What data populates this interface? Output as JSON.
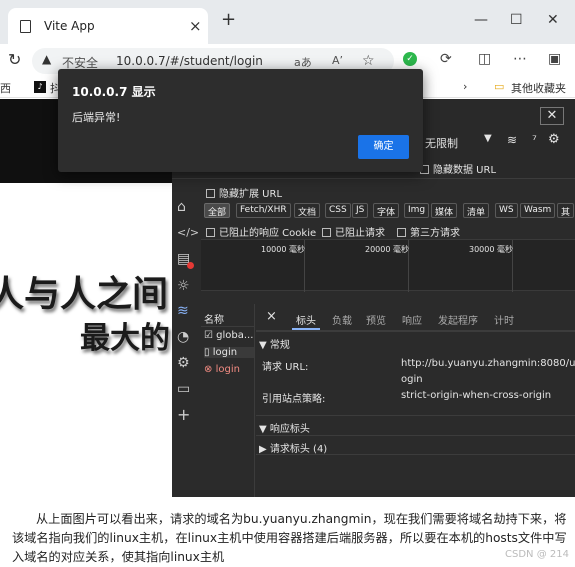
{
  "browser": {
    "tab_title": "Vite App",
    "tab_close": "×",
    "new_tab": "+",
    "window_minimize": "—",
    "window_maximize": "☐",
    "window_close": "✕",
    "security_label": "不安全",
    "url": "10.0.0.7/#/student/login",
    "reader_label": "aあ",
    "font_label": "Aʼ",
    "bookmark_left": "西",
    "bookmark_tiktok": "抖",
    "bookmark_folder": "其他收藏夹"
  },
  "page": {
    "heading_line1": "人与人之间",
    "heading_line2": "最大的"
  },
  "devtools": {
    "throttle": "无限制",
    "hide_data_url": "隐藏数据 URL",
    "hide_extension_url": "隐藏扩展 URL",
    "filters": [
      "全部",
      "Fetch/XHR",
      "文档",
      "CSS",
      "JS",
      "字体",
      "Img",
      "媒体",
      "清单",
      "WS",
      "Wasm",
      "其"
    ],
    "blocked_cookies": "已阻止的响应 Cookie",
    "blocked_requests": "已阻止请求",
    "third_party": "第三方请求",
    "timeline_ticks": [
      "10000 毫秒",
      "20000 毫秒",
      "30000 毫秒"
    ],
    "list_header": "名称",
    "requests": [
      {
        "name": "globa...",
        "status": "ok"
      },
      {
        "name": "login",
        "status": "ok"
      },
      {
        "name": "login",
        "status": "error"
      }
    ],
    "detail_close": "×",
    "detail_tabs": [
      "标头",
      "负载",
      "预览",
      "响应",
      "发起程序",
      "计时"
    ],
    "general_title": "▼ 常规",
    "request_url_label": "请求 URL:",
    "request_url_value_line1": "http://bu.yuanyu.zhangmin:8080/user/l",
    "request_url_value_line2": "ogin",
    "referrer_label": "引用站点策略:",
    "referrer_value": "strict-origin-when-cross-origin",
    "response_headers": "▼ 响应标头",
    "request_headers": "▶ 请求标头 (4)"
  },
  "dialog": {
    "title": "10.0.0.7 显示",
    "message": "后端异常!",
    "ok": "确定"
  },
  "caption": "从上面图片可以看出来，请求的域名为bu.yuanyu.zhangmin，现在我们需要将域名劫持下来，将该域名指向我们的linux主机，在linux主机中使用容器搭建后端服务器，所以要在本机的hosts文件中写入域名的对应关系，使其指向linux主机",
  "watermark": "CSDN @ 214",
  "colors": {
    "accent": "#1a73e8",
    "error": "#f28b82",
    "devtools_bg": "#2b2b2b"
  }
}
